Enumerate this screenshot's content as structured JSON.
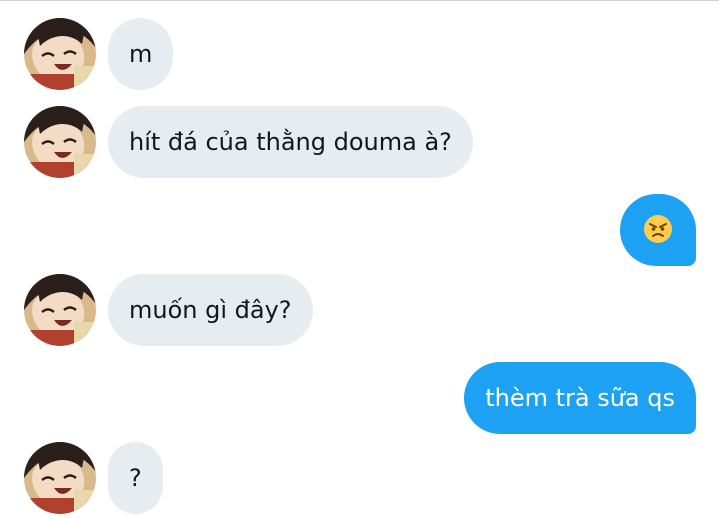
{
  "conversation": {
    "messages": [
      {
        "sender": "other",
        "text": "m"
      },
      {
        "sender": "other",
        "text": "hít đá của thằng douma à?"
      },
      {
        "sender": "me",
        "emoji": "angry-face-emoji"
      },
      {
        "sender": "other",
        "text": "muốn gì đây?"
      },
      {
        "sender": "me",
        "text": "thèm trà sữa qs"
      },
      {
        "sender": "other",
        "text": "?"
      }
    ]
  },
  "colors": {
    "incoming_bubble": "#e6ecf0",
    "outgoing_bubble": "#1da1f2",
    "incoming_text": "#14171a",
    "outgoing_text": "#ffffff"
  }
}
